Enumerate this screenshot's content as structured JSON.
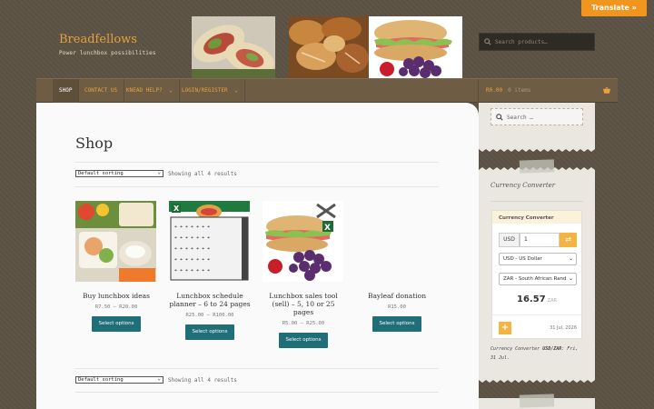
{
  "translate_label": "Translate »",
  "site": {
    "title": "Breadfellows",
    "tagline": "Power lunchbox possibilities"
  },
  "header_search": {
    "placeholder": "Search products…"
  },
  "nav": {
    "items": [
      {
        "label": "SHOP",
        "caret": false
      },
      {
        "label": "CONTACT US",
        "caret": false
      },
      {
        "label": "KNEAD HELP?",
        "caret": true
      },
      {
        "label": "LOGIN/REGISTER",
        "caret": true
      }
    ],
    "cart_total": "R0.00",
    "cart_items": "0 items"
  },
  "shop": {
    "title": "Shop",
    "sorting": "Default sorting",
    "result_count": "Showing all 4 results",
    "products": [
      {
        "name": "Buy lunchbox ideas",
        "price": "R7.50 – R20.00",
        "button": "Select options"
      },
      {
        "name": "Lunchbox schedule planner – 6 to 24 pages",
        "price": "R25.00 – R100.00",
        "button": "Select options"
      },
      {
        "name": "Lunchbox sales tool (sell) – 5, 10 or 25 pages",
        "price": "R5.00 – R25.00",
        "button": "Select options"
      },
      {
        "name": "Bayleaf donation",
        "price": "R15.00",
        "button": "Select options"
      }
    ]
  },
  "sidebar": {
    "search_placeholder": "Search …",
    "widget_title": "Currency Converter",
    "converter": {
      "heading": "Currency Converter",
      "from_code": "USD",
      "amount": "1",
      "from_select": "USD - US Dollar",
      "to_select": "ZAR - South African Rand",
      "result": "16.57",
      "result_currency": "ZAR",
      "date": "31 Jul, 2026",
      "note_prefix": "Currency Converter",
      "note_pair": "USD/ZAR",
      "note_suffix": ": Fri, 31 Jul."
    }
  },
  "colors": {
    "accent": "#e3a23a",
    "nav_bg": "#6e5d44",
    "button": "#1f6e78",
    "converter_accent": "#f5b342"
  }
}
